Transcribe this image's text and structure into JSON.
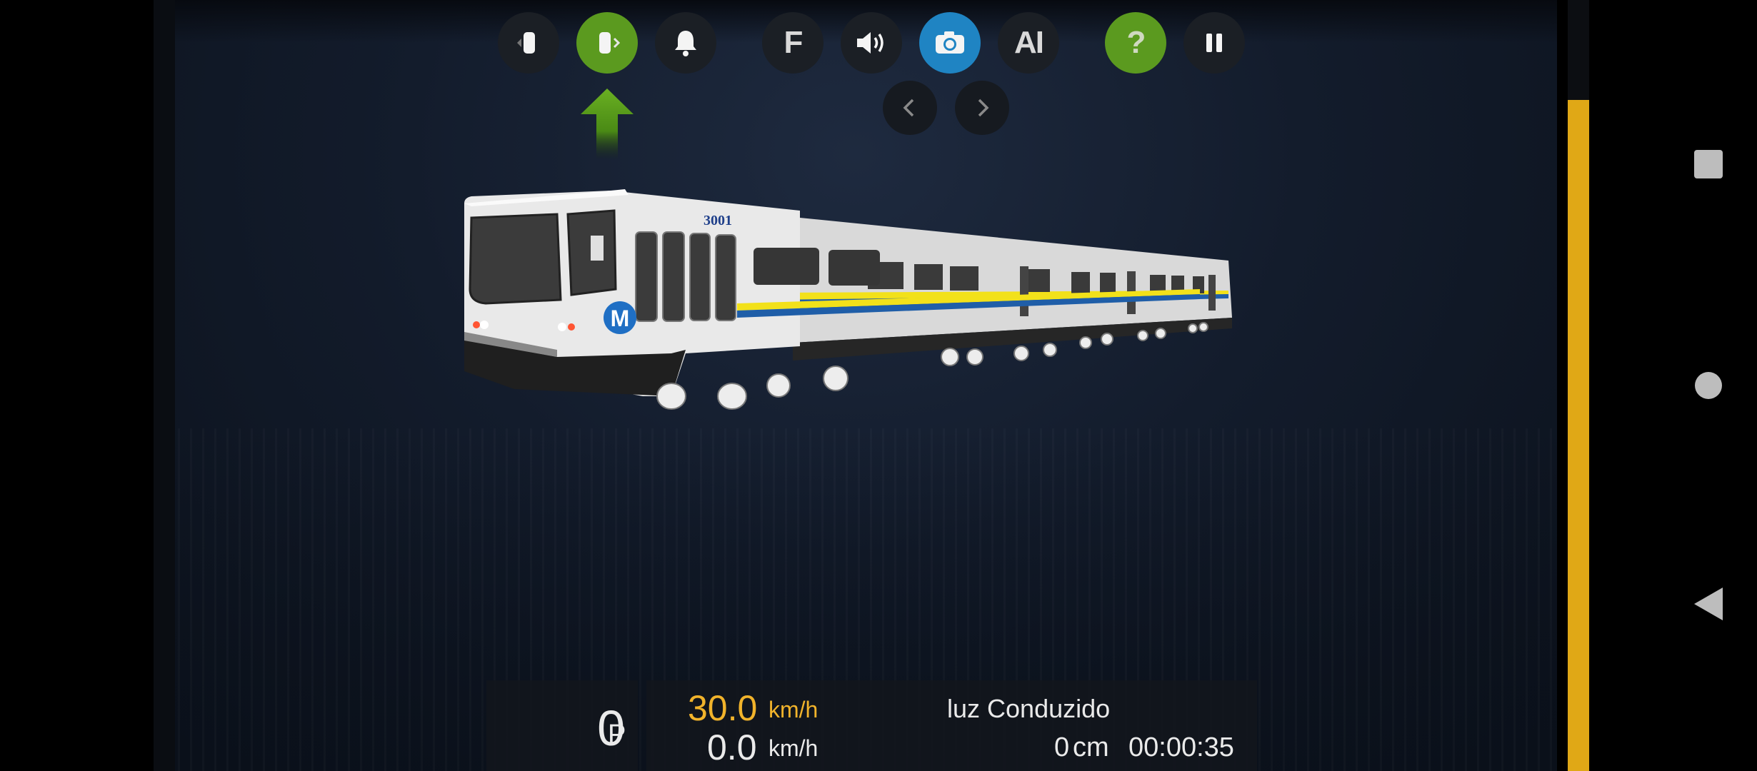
{
  "toolbar": {
    "buttons": [
      {
        "name": "prev-car-view",
        "icon": "car-left-icon"
      },
      {
        "name": "next-car-view",
        "icon": "car-right-icon",
        "active": true
      },
      {
        "name": "bell",
        "icon": "bell-icon"
      },
      {
        "name": "f",
        "label": "F"
      },
      {
        "name": "sound",
        "icon": "speaker-icon"
      },
      {
        "name": "camera",
        "icon": "camera-icon",
        "active": true
      },
      {
        "name": "ai",
        "label": "AI"
      },
      {
        "name": "help",
        "label": "?"
      },
      {
        "name": "pause",
        "icon": "pause-icon"
      }
    ],
    "camera_nav": {
      "left_icon": "chevron-left-icon",
      "right_icon": "chevron-right-icon"
    }
  },
  "train": {
    "number": "3001",
    "logo_letter": "M",
    "colors": {
      "body": "#e8e8e8",
      "stripe_yellow": "#f2e11a",
      "stripe_blue": "#1f5ea8"
    }
  },
  "hud": {
    "power_value": "0",
    "power_unit": "P",
    "target_speed": "30.0",
    "target_speed_unit": "km/h",
    "current_speed": "0.0",
    "current_speed_unit": "km/h",
    "status_label": "luz Conduzido",
    "distance_value": "0",
    "distance_unit": "cm",
    "elapsed_time": "00:00:35"
  },
  "throttle": {
    "level": 0.87,
    "color": "#e0a816"
  },
  "android_nav": {
    "recent": "square-icon",
    "home": "circle-icon",
    "back": "triangle-back-icon"
  }
}
